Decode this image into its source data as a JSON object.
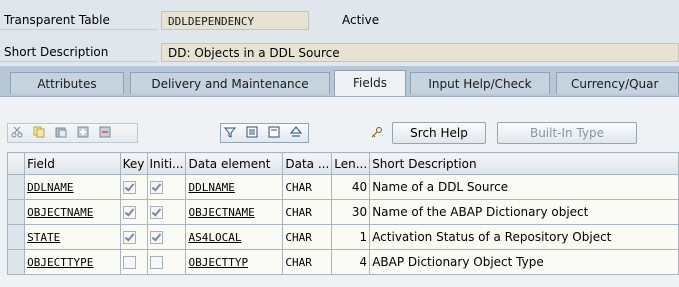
{
  "header": {
    "table_type_label": "Transparent Table",
    "table_name": "DDLDEPENDENCY",
    "status": "Active",
    "short_desc_label": "Short Description",
    "short_desc_value": "DD: Objects in a DDL Source"
  },
  "tabs": [
    {
      "label": "Attributes"
    },
    {
      "label": "Delivery and Maintenance"
    },
    {
      "label": "Fields",
      "active": true
    },
    {
      "label": "Input Help/Check"
    },
    {
      "label": "Currency/Quar"
    }
  ],
  "toolbar": {
    "srch_help_label": "Srch Help",
    "built_in_type_label": "Built-In Type"
  },
  "grid": {
    "columns": [
      "Field",
      "Key",
      "Initi...",
      "Data element",
      "Data ...",
      "Len...",
      "Short Description"
    ],
    "rows": [
      {
        "field": "DDLNAME",
        "key": true,
        "init": true,
        "data_element": "DDLNAME",
        "data_type": "CHAR",
        "length": "40",
        "short_desc": "Name of a DDL Source"
      },
      {
        "field": "OBJECTNAME",
        "key": true,
        "init": true,
        "data_element": "OBJECTNAME",
        "data_type": "CHAR",
        "length": "30",
        "short_desc": "Name of the ABAP Dictionary object"
      },
      {
        "field": "STATE",
        "key": true,
        "init": true,
        "data_element": "AS4LOCAL",
        "data_type": "CHAR",
        "length": "1",
        "short_desc": "Activation Status of a Repository Object"
      },
      {
        "field": "OBJECTTYPE",
        "key": false,
        "init": false,
        "data_element": "OBJECTTYP",
        "data_type": "CHAR",
        "length": "4",
        "short_desc": "ABAP Dictionary Object Type"
      }
    ]
  },
  "colors": {
    "background": "#dfe6ec",
    "field_bg": "#e8e2d3",
    "tabstrip": "#b7c7d6"
  }
}
